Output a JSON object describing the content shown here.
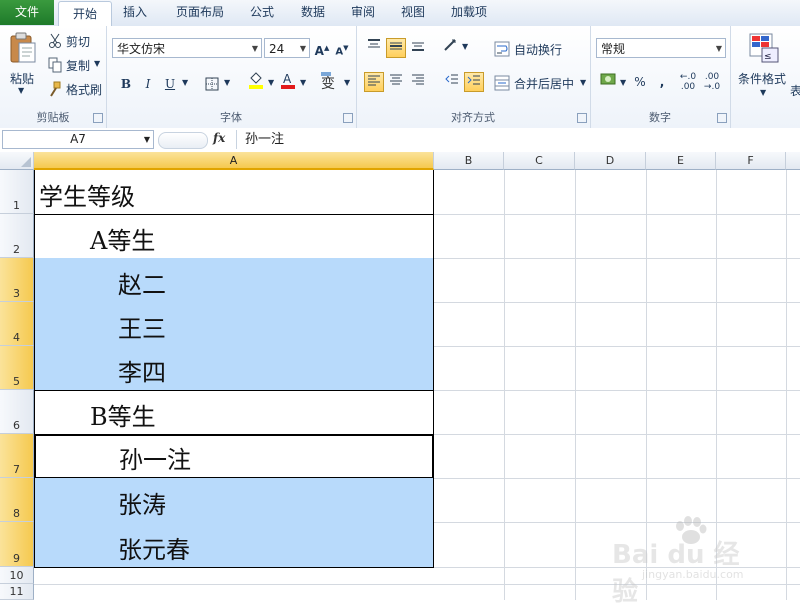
{
  "tabs": [
    "文件",
    "开始",
    "插入",
    "页面布局",
    "公式",
    "数据",
    "审阅",
    "视图",
    "加载项"
  ],
  "clipboard": {
    "paste": "粘贴",
    "cut": "剪切",
    "copy": "复制",
    "format_painter": "格式刷",
    "label": "剪贴板"
  },
  "font": {
    "name": "华文仿宋",
    "size": "24",
    "bold": "B",
    "italic": "I",
    "underline": "U",
    "label": "字体"
  },
  "alignment": {
    "wrap_text": "自动换行",
    "merge_center": "合并后居中",
    "label": "对齐方式"
  },
  "number": {
    "format": "常规",
    "percent": "%",
    "comma": ",",
    "label": "数字"
  },
  "styles": {
    "conditional_format": "条件格式",
    "table_partial": "表"
  },
  "formula_bar": {
    "name_box": "A7",
    "fx": "fx",
    "content": "孙一注"
  },
  "columns": [
    "A",
    "B",
    "C",
    "D",
    "E",
    "F"
  ],
  "rows": [
    "1",
    "2",
    "3",
    "4",
    "5",
    "6",
    "7",
    "8",
    "9",
    "10",
    "11"
  ],
  "cells": [
    "学生等级",
    "A等生",
    "赵二",
    "王三",
    "李四",
    "B等生",
    "孙一注",
    "张涛",
    "张元春"
  ],
  "watermark": {
    "brand": "Bai du 经验",
    "url": "jingyan.baidu.com"
  },
  "colors": {
    "selection_blue": "#b8dafb",
    "header_highlight": "#f5c94f",
    "file_tab": "#2a8a36"
  }
}
